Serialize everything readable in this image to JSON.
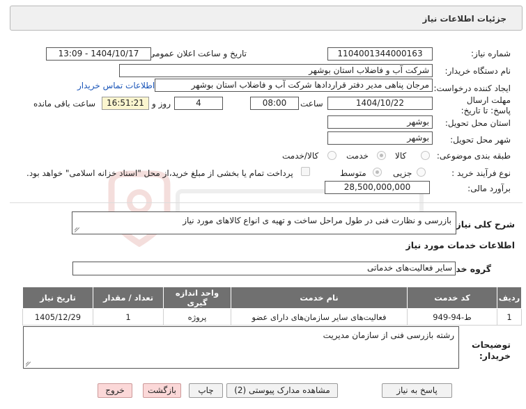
{
  "header": {
    "title": "جزئیات اطلاعات نیاز"
  },
  "fields": {
    "need_number_label": "شماره نیاز:",
    "need_number": "1104001344000163",
    "announce_label": "تاریخ و ساعت اعلان عمومی:",
    "announce_value": "1404/10/17 - 13:09",
    "buyer_org_label": "نام دستگاه خریدار:",
    "buyer_org": "شرکت آب و فاضلاب استان بوشهر",
    "creator_label": "ایجاد کننده درخواست:",
    "creator": "مرجان پناهی مدیر دفتر قراردادها شرکت آب و فاضلاب استان بوشهر",
    "contact_link": "اطلاعات تماس خریدار",
    "deadline_label": "مهلت ارسال پاسخ: تا تاریخ:",
    "deadline_date": "1404/10/22",
    "time_label": "ساعت",
    "deadline_time": "08:00",
    "days_value": "4",
    "days_label": "روز و",
    "remaining_time": "16:51:21",
    "remaining_label": "ساعت باقی مانده",
    "province_label": "استان محل تحویل:",
    "province": "بوشهر",
    "city_label": "شهر محل تحویل:",
    "city": "بوشهر",
    "category_label": "طبقه بندی موضوعی:",
    "category_options": [
      "کالا",
      "خدمت",
      "کالا/خدمت"
    ],
    "process_label": "نوع فرآیند خرید :",
    "process_options": [
      "جزیی",
      "متوسط"
    ],
    "payment_note": "پرداخت تمام یا بخشی از مبلغ خرید،از محل \"اسناد خزانه اسلامی\" خواهد بود.",
    "budget_label": "برآورد مالی:",
    "budget": "28,500,000,000"
  },
  "description": {
    "label": "شرح کلی نیاز:",
    "value": "بازرسی و نظارت فنی در طول مراحل ساخت و تهیه ی انواع کالاهای مورد نیاز"
  },
  "services": {
    "section_title": "اطلاعات خدمات مورد نیاز",
    "group_label": "گروه خدمت:",
    "group_value": "سایر فعالیت‌های خدماتی",
    "columns": [
      "ردیف",
      "کد خدمت",
      "نام خدمت",
      "واحد اندازه گیری",
      "تعداد / مقدار",
      "تاریخ نیاز"
    ],
    "rows": [
      [
        "1",
        "ط-94-949",
        "فعالیت‌های سایر سازمان‌های دارای عضو",
        "پروژه",
        "1",
        "1405/12/29"
      ]
    ]
  },
  "buyer_notes": {
    "label": "توضیحات خریدار:",
    "value": "رشته بازرسی فنی از سازمان مدیریت"
  },
  "buttons": {
    "reply": "پاسخ به نیاز",
    "attachments": "مشاهده مدارک پیوستی (2)",
    "print": "چاپ",
    "back": "بازگشت",
    "exit": "خروج"
  },
  "colors": {
    "table_header": "#707070",
    "link": "#1a55b8",
    "remaining_bg": "#fbf6cf",
    "exit_bg": "#fbd8d8"
  }
}
